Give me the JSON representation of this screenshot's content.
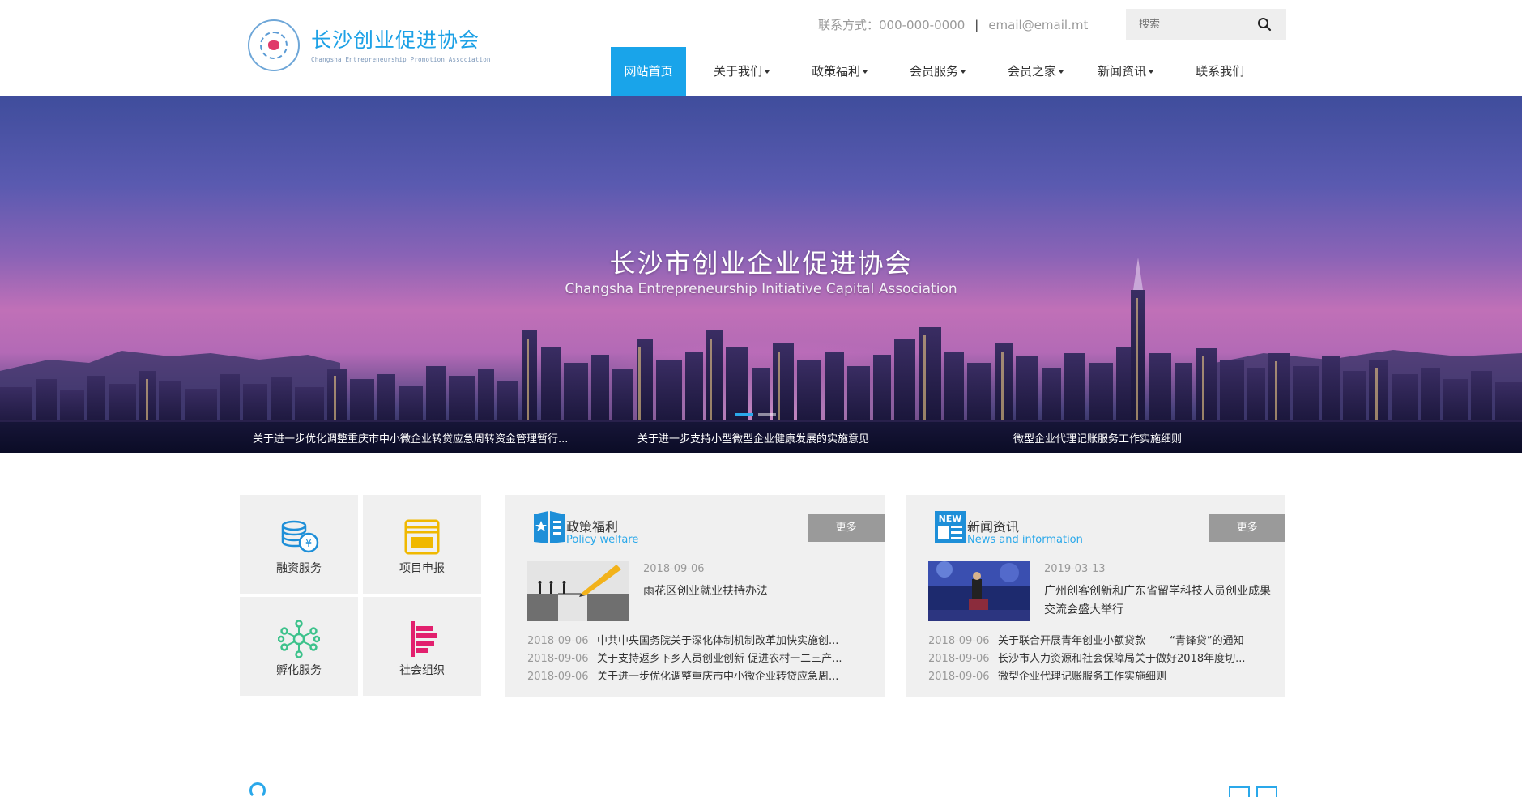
{
  "header": {
    "logo_cn": "长沙创业促进协会",
    "logo_en": "Changsha Entrepreneurship Promotion Association",
    "contact_label": "联系方式：000-000-0000",
    "separator": "|",
    "email": "email@email.mt",
    "search_placeholder": "搜索"
  },
  "nav": [
    {
      "label": "网站首页",
      "active": true,
      "dropdown": false
    },
    {
      "label": "关于我们",
      "active": false,
      "dropdown": true
    },
    {
      "label": "政策福利",
      "active": false,
      "dropdown": true
    },
    {
      "label": "会员服务",
      "active": false,
      "dropdown": true
    },
    {
      "label": "会员之家",
      "active": false,
      "dropdown": true
    },
    {
      "label": "新闻资讯",
      "active": false,
      "dropdown": true
    },
    {
      "label": "联系我们",
      "active": false,
      "dropdown": false
    }
  ],
  "banner": {
    "title": "长沙市创业企业促进协会",
    "subtitle": "Changsha Entrepreneurship Initiative Capital Association",
    "tickers": [
      "关于进一步优化调整重庆市中小微企业转贷应急周转资金管理暂行...",
      "关于进一步支持小型微型企业健康发展的实施意见",
      "微型企业代理记账服务工作实施细则"
    ]
  },
  "services": [
    {
      "label": "融资服务",
      "icon": "coins-icon"
    },
    {
      "label": "项目申报",
      "icon": "folder-icon"
    },
    {
      "label": "孵化服务",
      "icon": "network-icon"
    },
    {
      "label": "社会组织",
      "icon": "org-chart-icon"
    }
  ],
  "policy": {
    "title": "政策福利",
    "subtitle": "Policy welfare",
    "more": "更多",
    "featured": {
      "date": "2018-09-06",
      "title": "雨花区创业就业扶持办法"
    },
    "items": [
      {
        "date": "2018-09-06",
        "title": "中共中央国务院关于深化体制机制改革加快实施创..."
      },
      {
        "date": "2018-09-06",
        "title": "关于支持返乡下乡人员创业创新 促进农村一二三产..."
      },
      {
        "date": "2018-09-06",
        "title": "关于进一步优化调整重庆市中小微企业转贷应急周..."
      }
    ]
  },
  "news": {
    "title": "新闻资讯",
    "subtitle": "News and information",
    "more": "更多",
    "featured": {
      "date": "2019-03-13",
      "title": "广州创客创新和广东省留学科技人员创业成果交流会盛大举行"
    },
    "items": [
      {
        "date": "2018-09-06",
        "title": "关于联合开展青年创业小额贷款 ——“青锋贷”的通知"
      },
      {
        "date": "2018-09-06",
        "title": "长沙市人力资源和社会保障局关于做好2018年度切..."
      },
      {
        "date": "2018-09-06",
        "title": "微型企业代理记账服务工作实施细则"
      }
    ]
  },
  "colors": {
    "accent": "#19a4ea",
    "panel_bg": "#f0f0f0",
    "more_btn": "#9a9a9a"
  }
}
